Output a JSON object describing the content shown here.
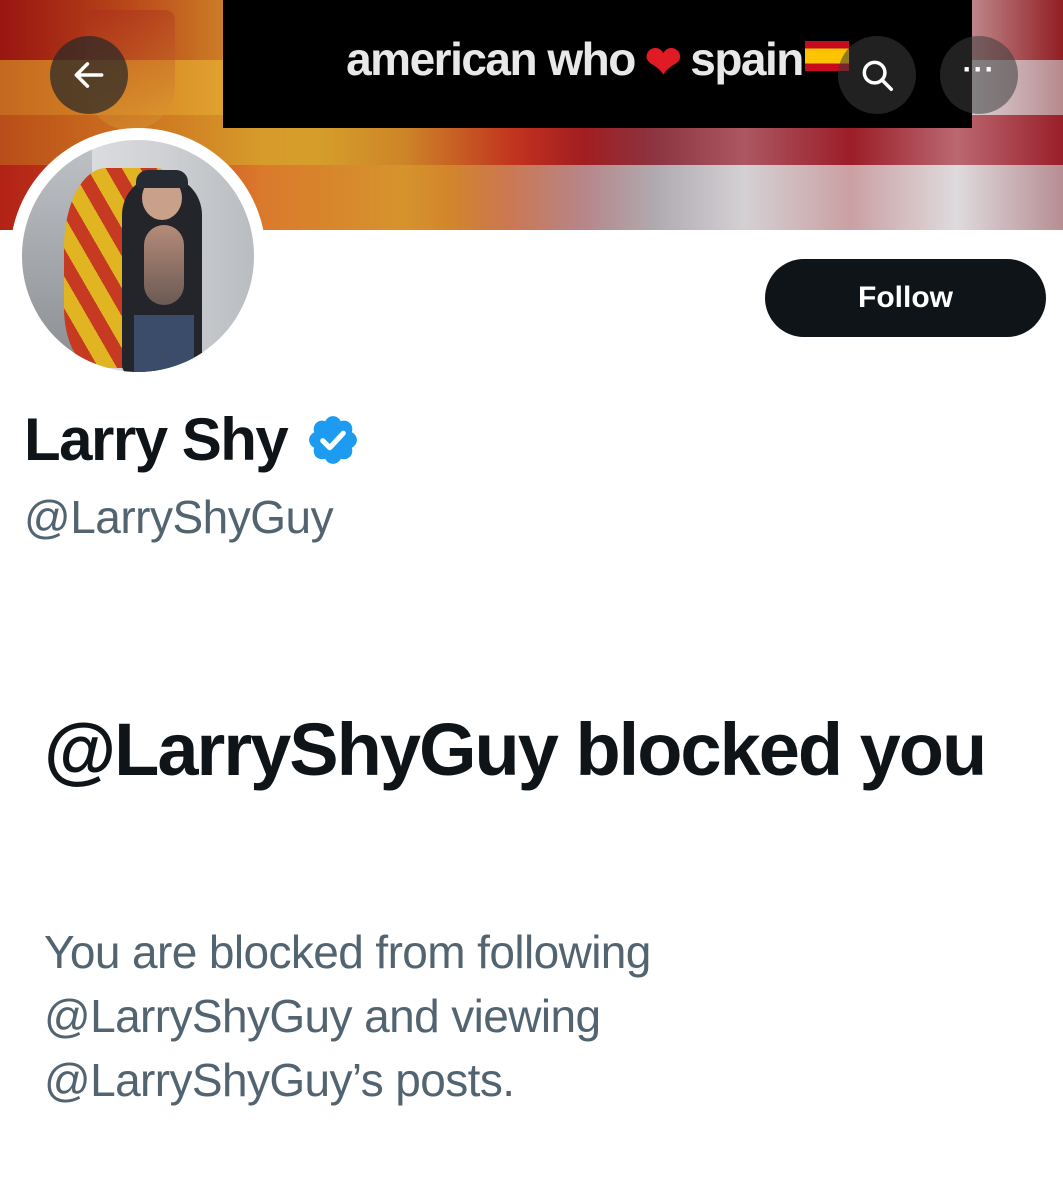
{
  "banner": {
    "title_part1": "american who",
    "title_heart": "❤",
    "title_part2": "spain",
    "title_flag_emoji": "spain-flag-emoji"
  },
  "toolbar": {
    "back_icon": "arrow-left-icon",
    "search_icon": "search-icon",
    "more_label": "···"
  },
  "profile": {
    "display_name": "Larry Shy",
    "verified": true,
    "handle": "@LarryShyGuy",
    "follow_label": "Follow"
  },
  "blocked": {
    "title": "@LarryShyGuy blocked you",
    "description": "You are blocked from following @LarryShyGuy and viewing @LarryShyGuy’s posts."
  },
  "colors": {
    "primary_text": "#0f1419",
    "secondary_text": "#536471",
    "verified_blue": "#1d9bf0",
    "button_bg": "#0f1419"
  }
}
